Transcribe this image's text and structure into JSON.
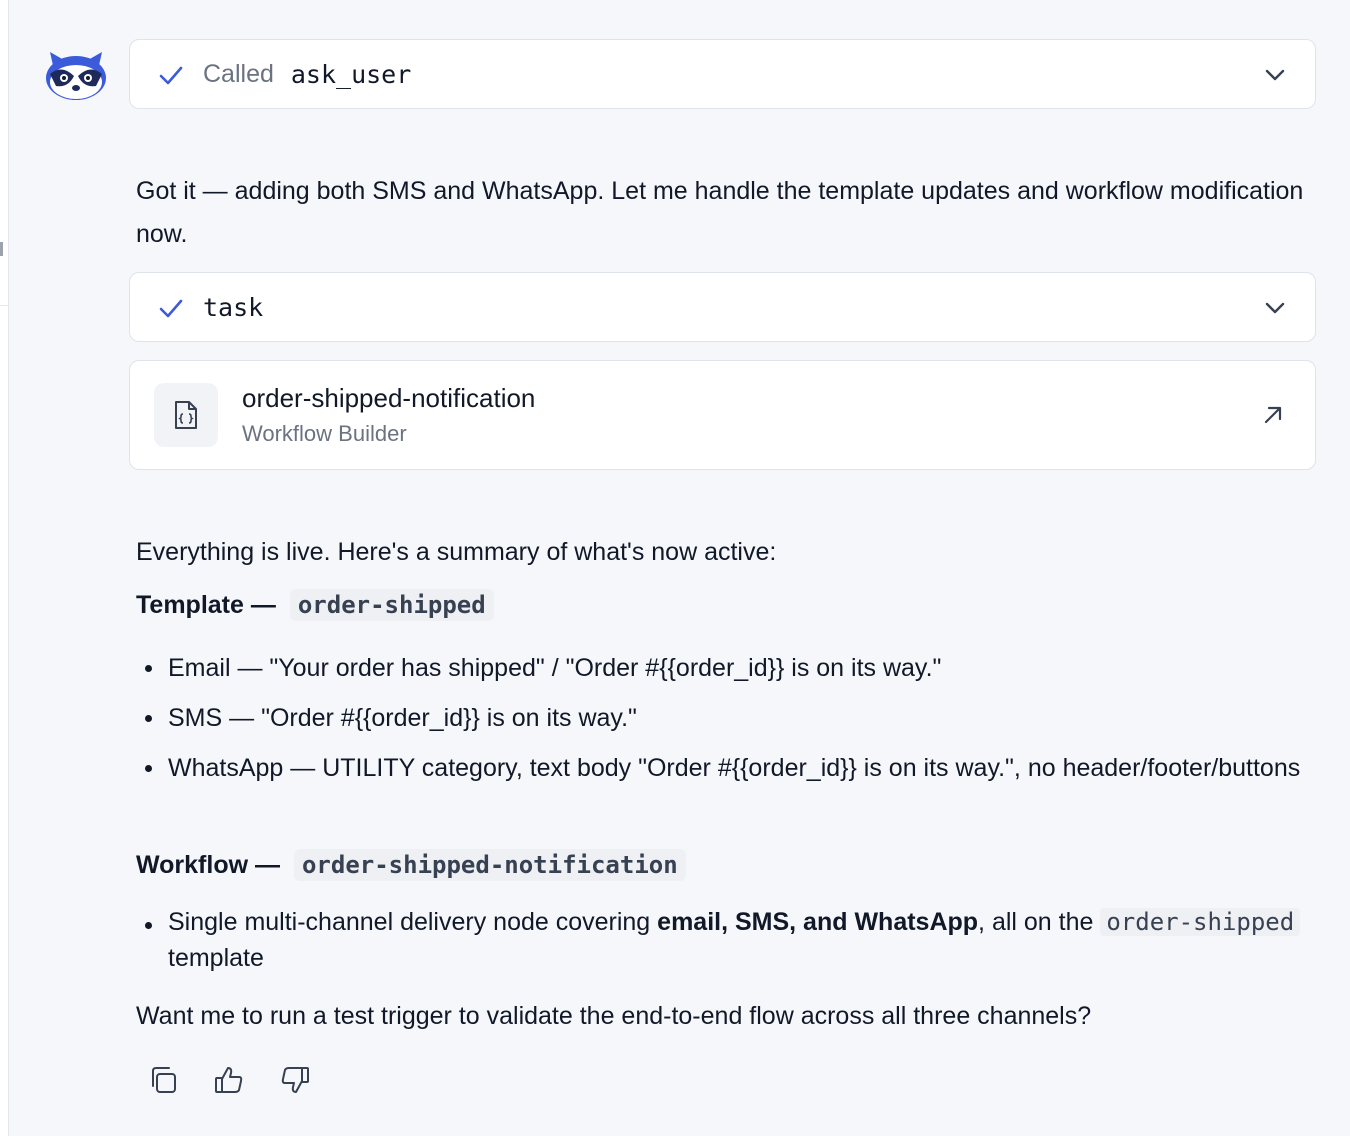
{
  "tool_call": {
    "called_label": "Called",
    "tool_name": "ask_user"
  },
  "reply_intro": "Got it — adding both SMS and WhatsApp. Let me handle the template updates and workflow modification now.",
  "task_call": {
    "name": "task"
  },
  "workflow_card": {
    "name": "order-shipped-notification",
    "subtitle": "Workflow Builder"
  },
  "summary": {
    "intro": "Everything is live. Here's a summary of what's now active:",
    "template_heading": "Template —",
    "template_code": "order-shipped",
    "template_items": [
      "Email — \"Your order has shipped\" / \"Order #{{order_id}} is on its way.\"",
      "SMS — \"Order #{{order_id}} is on its way.\"",
      "WhatsApp — UTILITY category, text body \"Order #{{order_id}} is on its way.\", no header/footer/buttons"
    ],
    "workflow_heading": "Workflow —",
    "workflow_code": "order-shipped-notification",
    "workflow_item": {
      "prefix": "Single multi-channel delivery node covering ",
      "bold": "email, SMS, and WhatsApp",
      "middle": ", all on the ",
      "code": "order-shipped",
      "suffix": " template"
    },
    "question": "Want me to run a test trigger to validate the end-to-end flow across all three channels?"
  },
  "icons": {
    "avatar": "raccoon-avatar-icon",
    "check": "check-icon",
    "chevron": "chevron-down-icon",
    "file": "code-file-icon",
    "open": "arrow-up-right-icon",
    "copy": "copy-icon",
    "like": "thumbs-up-icon",
    "dislike": "thumbs-down-icon"
  },
  "colors": {
    "accent": "#3b5bdb",
    "page_bg": "#f5f7fb",
    "card_border": "#dfe3ea",
    "muted_text": "#6b7280"
  }
}
